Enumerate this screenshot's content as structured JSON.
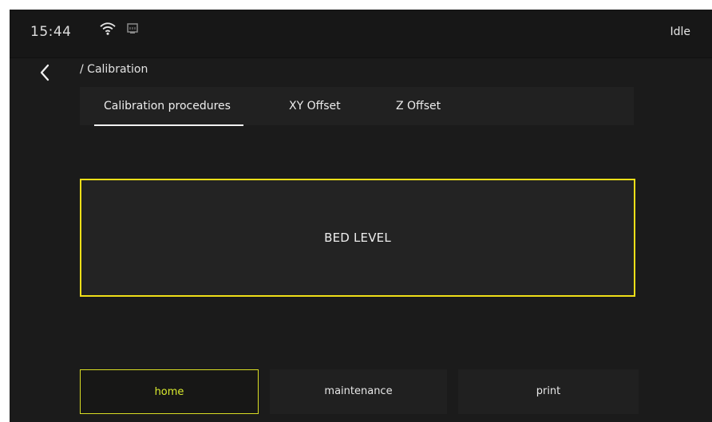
{
  "status_bar": {
    "time": "15:44",
    "wifi_icon": "wifi-icon",
    "ethernet_icon": "ethernet-icon",
    "status": "Idle"
  },
  "header": {
    "back_icon": "back-chevron-icon",
    "breadcrumb": "/ Calibration"
  },
  "tabs": [
    {
      "label": "Calibration procedures",
      "active": true
    },
    {
      "label": "XY Offset",
      "active": false
    },
    {
      "label": "Z Offset",
      "active": false
    }
  ],
  "main": {
    "bed_level_button": "BED LEVEL"
  },
  "bottom_nav": [
    {
      "label": "home",
      "active": true
    },
    {
      "label": "maintenance",
      "active": false
    },
    {
      "label": "print",
      "active": false
    }
  ],
  "colors": {
    "accent_yellow": "#f0df18",
    "active_nav_text": "#d9ea2f",
    "background": "#1b1b1b"
  }
}
